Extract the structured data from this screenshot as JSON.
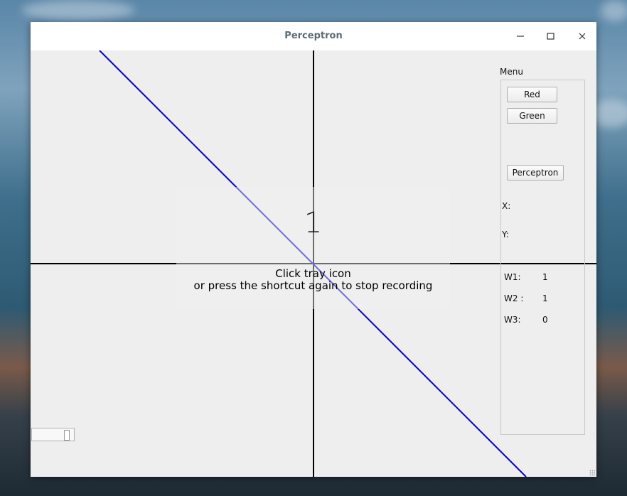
{
  "window": {
    "title": "Perceptron"
  },
  "titlebar_buttons": [
    "minimize-icon",
    "maximize-icon",
    "close-icon"
  ],
  "menu": {
    "label": "Menu",
    "buttons": {
      "red": "Red",
      "green": "Green",
      "perceptron": "Perceptron"
    },
    "coords": {
      "x_label": "X:",
      "y_label": "Y:"
    },
    "weights": [
      {
        "label": "W1:",
        "value": "1"
      },
      {
        "label": "W2 :",
        "value": "1"
      },
      {
        "label": "W3:",
        "value": "0"
      }
    ]
  },
  "overlay": {
    "count": "1",
    "line1": "Click tray icon",
    "line2": "or press the shortcut again to stop recording"
  },
  "colors": {
    "decision_line": "#0000cc",
    "axes": "#000000",
    "title_text": "#5b6b75"
  }
}
